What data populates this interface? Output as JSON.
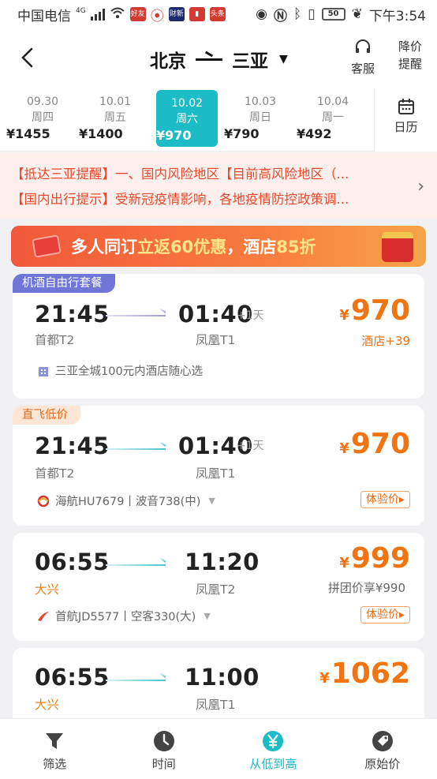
{
  "status": {
    "carrier": "中国电信",
    "net": "4G",
    "battery": "50",
    "time": "下午3:54",
    "badges": [
      "好友",
      "财新",
      "头条"
    ]
  },
  "header": {
    "from": "北京",
    "to": "三亚",
    "service_label": "客服",
    "remind_label_1": "降价",
    "remind_label_2": "提醒"
  },
  "dates": [
    {
      "date": "09.30",
      "weekday": "周四",
      "price": "¥1455"
    },
    {
      "date": "10.01",
      "weekday": "周五",
      "price": "¥1400"
    },
    {
      "date": "10.02",
      "weekday": "周六",
      "price": "¥970"
    },
    {
      "date": "10.03",
      "weekday": "周日",
      "price": "¥790"
    },
    {
      "date": "10.04",
      "weekday": "周一",
      "price": "¥492"
    }
  ],
  "calendar_label": "日历",
  "notice": {
    "line1": "【抵达三亚提醒】一、国内风险地区【目前高风险地区（...",
    "line2": "【国内出行提示】受新冠疫情影响，各地疫情防控政策调..."
  },
  "promo": {
    "part1": "多人同订",
    "part2": "立返60优惠",
    "part3": "，酒店",
    "part4": "85折"
  },
  "flights": [
    {
      "tag": "机酒自由行套餐",
      "dep_time": "21:45",
      "arr_time": "01:40",
      "plus": "+1天",
      "dep_apt": "首都T2",
      "arr_apt": "凤凰T1",
      "price_cur": "¥",
      "price": "970",
      "sub": "酒店+39",
      "extra": "三亚全城100元内酒店随心选"
    },
    {
      "tag": "直飞低价",
      "dep_time": "21:45",
      "arr_time": "01:40",
      "plus": "+1天",
      "dep_apt": "首都T2",
      "arr_apt": "凤凰T1",
      "price_cur": "¥",
      "price": "970",
      "airline": "海航HU7679丨波音738(中)",
      "exp": "体验价▸"
    },
    {
      "dep_time": "06:55",
      "arr_time": "11:20",
      "dep_apt": "大兴",
      "arr_apt": "凤凰T2",
      "price_cur": "¥",
      "price": "999",
      "sub": "拼团价享¥990",
      "airline": "首航JD5577丨空客330(大)",
      "exp": "体验价▸"
    },
    {
      "dep_time": "06:55",
      "arr_time": "11:00",
      "dep_apt": "大兴",
      "arr_apt": "凤凰T1",
      "price_cur": "¥",
      "price": "1062"
    }
  ],
  "bottomnav": [
    {
      "label": "筛选",
      "icon": "filter-icon"
    },
    {
      "label": "时间",
      "icon": "clock-icon"
    },
    {
      "label": "从低到高",
      "icon": "yen-icon"
    },
    {
      "label": "原始价",
      "icon": "tag-icon"
    }
  ],
  "colors": {
    "accent": "#1bbcc6",
    "price": "#f07412",
    "notice": "#e9482d"
  }
}
